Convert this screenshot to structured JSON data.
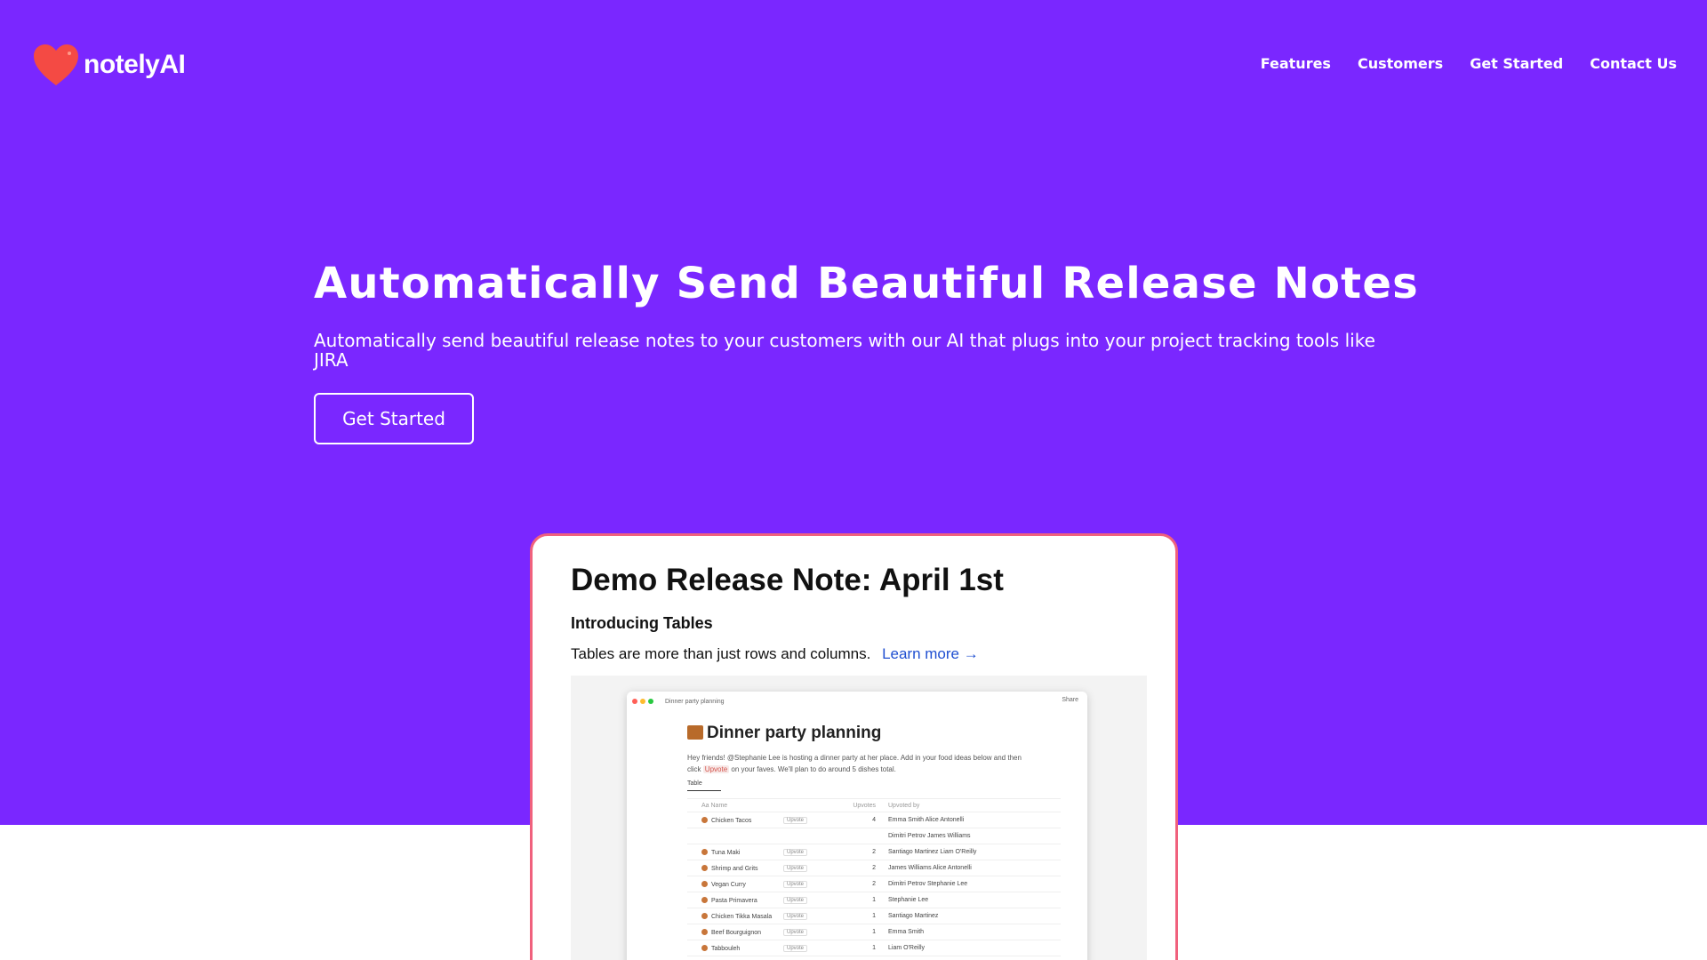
{
  "brand": {
    "name": "notelyAI",
    "logo_color": "#f44a44"
  },
  "colors": {
    "hero_bg": "#7a27ff",
    "card_border": "#f0617d",
    "link": "#1f4fd1"
  },
  "nav": {
    "items": [
      "Features",
      "Customers",
      "Get Started",
      "Contact Us"
    ]
  },
  "hero": {
    "title": "Automatically Send Beautiful Release Notes",
    "subtitle": "Automatically send beautiful release notes to your customers with our AI that plugs into your project tracking tools like JIRA",
    "cta_label": "Get Started"
  },
  "card": {
    "title": "Demo Release Note: April 1st",
    "subtitle": "Introducing Tables",
    "description": "Tables are more than just rows and columns.",
    "link_label": "Learn more →"
  },
  "preview": {
    "breadcrumb": "Dinner party planning",
    "share_label": "Share",
    "doc_title": "Dinner party planning",
    "doc_desc_a": "Hey friends! @Stephanie Lee is hosting a dinner party at her place. Add in your food ideas below and then click",
    "doc_desc_chip": "Upvote",
    "doc_desc_b": "on your faves. We'll plan to do around 5 dishes total.",
    "view_tab": "Table",
    "columns": [
      "Aa Name",
      "",
      "Upvotes",
      "Upvoted by"
    ],
    "rows": [
      {
        "name": "Chicken Tacos",
        "vote": "Upvote",
        "count": "4",
        "by": "Emma Smith   Alice Antonelli"
      },
      {
        "name": "",
        "vote": "",
        "count": "",
        "by": "Dimitri Petrov   James Williams"
      },
      {
        "name": "Tuna Maki",
        "vote": "Upvote",
        "count": "2",
        "by": "Santiago Martinez   Liam O'Reilly"
      },
      {
        "name": "Shrimp and Grits",
        "vote": "Upvote",
        "count": "2",
        "by": "James Williams   Alice Antonelli"
      },
      {
        "name": "Vegan Curry",
        "vote": "Upvote",
        "count": "2",
        "by": "Dimitri Petrov   Stephanie Lee"
      },
      {
        "name": "Pasta Primavera",
        "vote": "Upvote",
        "count": "1",
        "by": "Stephanie Lee"
      },
      {
        "name": "Chicken Tikka Masala",
        "vote": "Upvote",
        "count": "1",
        "by": "Santiago Martinez"
      },
      {
        "name": "Beef Bourguignon",
        "vote": "Upvote",
        "count": "1",
        "by": "Emma Smith"
      },
      {
        "name": "Tabbouleh",
        "vote": "Upvote",
        "count": "1",
        "by": "Liam O'Reilly"
      }
    ]
  }
}
